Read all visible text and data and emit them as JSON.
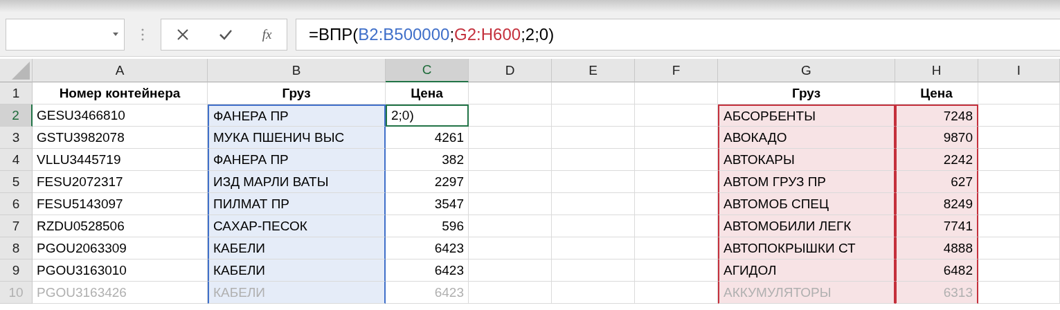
{
  "formula_bar": {
    "function_label": "fx",
    "formula": [
      {
        "text": "=ВПР(",
        "color": "#000000"
      },
      {
        "text": "B2:B500000",
        "color": "#3f6fc9"
      },
      {
        "text": ";",
        "color": "#000000"
      },
      {
        "text": "G2:H600",
        "color": "#c4303c"
      },
      {
        "text": ";2;0)",
        "color": "#000000"
      }
    ]
  },
  "columns": [
    {
      "letter": "A",
      "selected": false,
      "kind": "text"
    },
    {
      "letter": "B",
      "selected": false,
      "kind": "text",
      "color": "#3f6fc9"
    },
    {
      "letter": "C",
      "selected": true,
      "kind": "number"
    },
    {
      "letter": "D",
      "selected": false,
      "kind": "text"
    },
    {
      "letter": "E",
      "selected": false,
      "kind": "text"
    },
    {
      "letter": "F",
      "selected": false,
      "kind": "text"
    },
    {
      "letter": "G",
      "selected": false,
      "kind": "text",
      "color": "#c4303c"
    },
    {
      "letter": "H",
      "selected": false,
      "kind": "number",
      "color": "#c4303c"
    },
    {
      "letter": "I",
      "selected": false,
      "kind": "text"
    }
  ],
  "rows": [
    {
      "number": "1",
      "selected": false,
      "header": true,
      "faded": false,
      "cells": {
        "A": "Номер контейнера",
        "B": "Груз",
        "C": "Цена",
        "G": "Груз",
        "H": "Цена"
      }
    },
    {
      "number": "2",
      "selected": true,
      "header": false,
      "faded": false,
      "cells": {
        "A": "GESU3466810",
        "B": "ФАНЕРА ПР",
        "C": "2;0)",
        "G": "АБСОРБЕНТЫ",
        "H": "7248"
      }
    },
    {
      "number": "3",
      "selected": false,
      "header": false,
      "faded": false,
      "cells": {
        "A": "GSTU3982078",
        "B": "МУКА ПШЕНИЧ ВЫС",
        "C": "4261",
        "G": "АВОКАДО",
        "H": "9870"
      }
    },
    {
      "number": "4",
      "selected": false,
      "header": false,
      "faded": false,
      "cells": {
        "A": "VLLU3445719",
        "B": "ФАНЕРА ПР",
        "C": "382",
        "G": "АВТОКАРЫ",
        "H": "2242"
      }
    },
    {
      "number": "5",
      "selected": false,
      "header": false,
      "faded": false,
      "cells": {
        "A": "FESU2072317",
        "B": "ИЗД МАРЛИ ВАТЫ",
        "C": "2297",
        "G": "АВТОМ ГРУЗ ПР",
        "H": "627"
      }
    },
    {
      "number": "6",
      "selected": false,
      "header": false,
      "faded": false,
      "cells": {
        "A": "FESU5143097",
        "B": "ПИЛМАТ ПР",
        "C": "3547",
        "G": "АВТОМОБ СПЕЦ",
        "H": "8249"
      }
    },
    {
      "number": "7",
      "selected": false,
      "header": false,
      "faded": false,
      "cells": {
        "A": "RZDU0528506",
        "B": "САХАР-ПЕСОК",
        "C": "596",
        "G": "АВТОМОБИЛИ ЛЕГК",
        "H": "7741"
      }
    },
    {
      "number": "8",
      "selected": false,
      "header": false,
      "faded": false,
      "cells": {
        "A": "PGOU2063309",
        "B": "КАБЕЛИ",
        "C": "6423",
        "G": "АВТОПОКРЫШКИ СТ",
        "H": "4888"
      }
    },
    {
      "number": "9",
      "selected": false,
      "header": false,
      "faded": false,
      "cells": {
        "A": "PGOU3163010",
        "B": "КАБЕЛИ",
        "C": "6423",
        "G": "АГИДОЛ",
        "H": "6482"
      }
    },
    {
      "number": "10",
      "selected": false,
      "header": false,
      "faded": true,
      "cells": {
        "A": "PGOU3163426",
        "B": "КАБЕЛИ",
        "C": "6423",
        "G": "АККУМУЛЯТОРЫ",
        "H": "6313"
      }
    }
  ]
}
